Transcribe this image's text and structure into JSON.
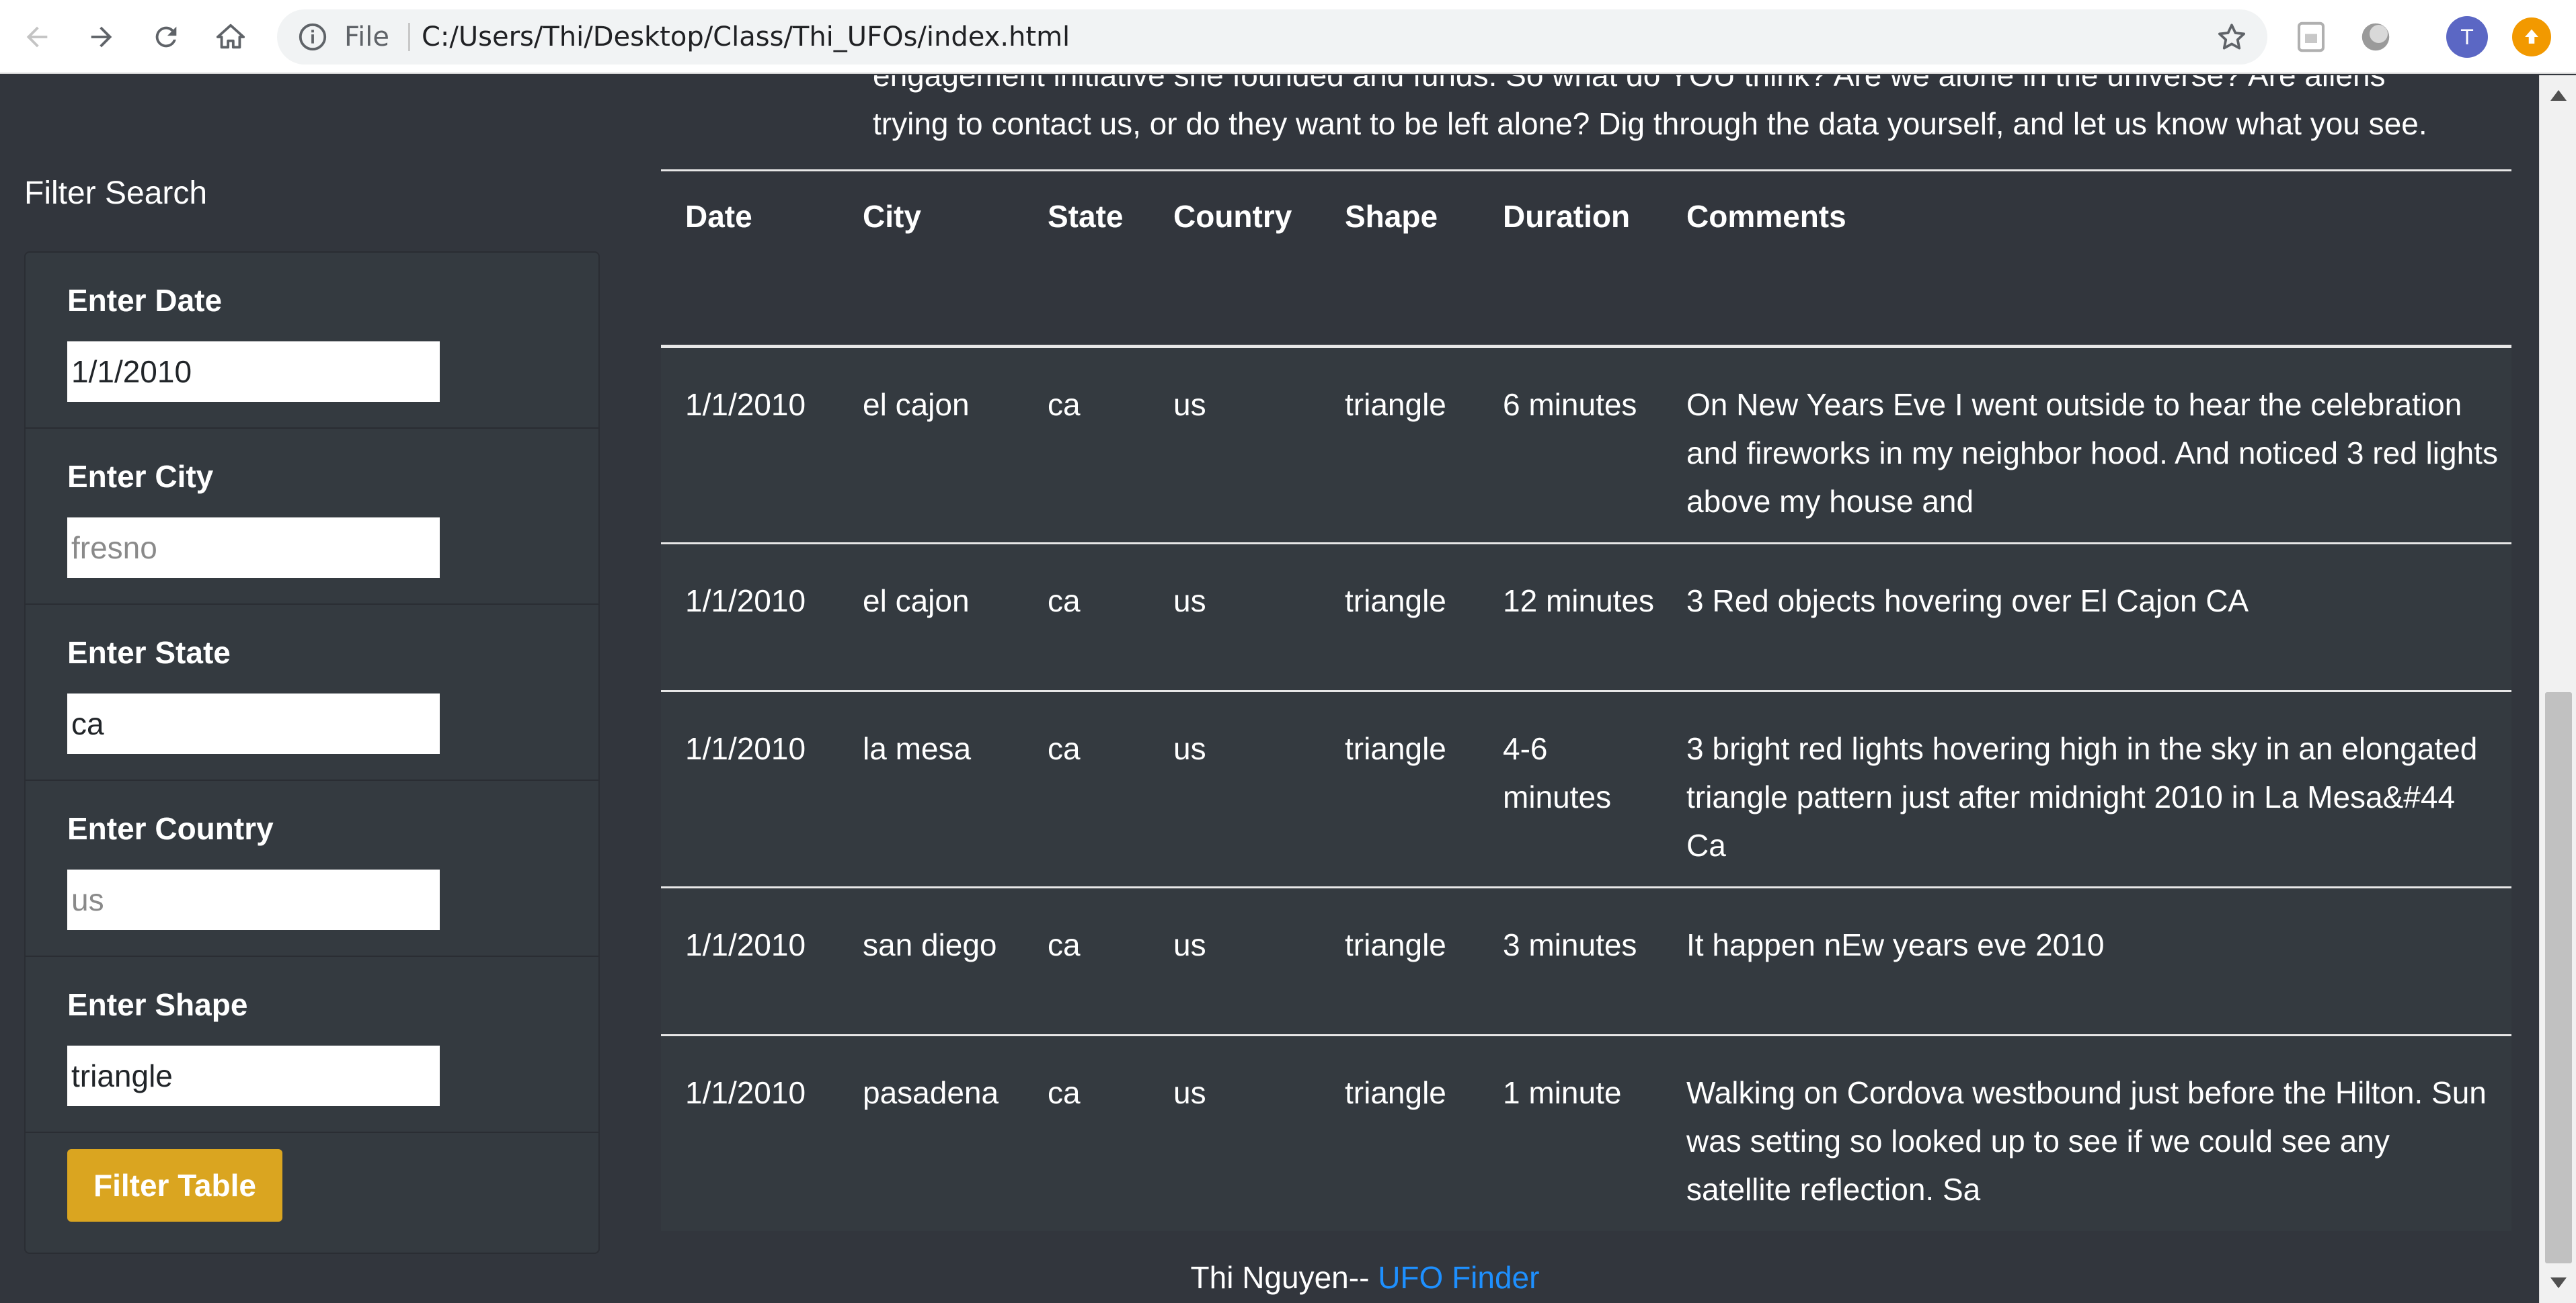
{
  "browser": {
    "scheme_label": "File",
    "url": "C:/Users/Thi/Desktop/Class/Thi_UFOs/index.html",
    "avatar_letter": "T",
    "icons": [
      "back-arrow-icon",
      "forward-arrow-icon",
      "reload-icon",
      "home-icon",
      "info-icon",
      "star-icon",
      "extension-icon",
      "update-icon"
    ]
  },
  "intro": {
    "line1": "engagement initiative she founded and funds. So what do YOU think? Are we alone in the universe? Are aliens",
    "line2": "trying to contact us, or do they want to be left alone? Dig through the data yourself, and let us know what you see."
  },
  "filter": {
    "heading": "Filter Search",
    "fields": [
      {
        "label": "Enter Date",
        "value": "1/1/2010",
        "placeholder": ""
      },
      {
        "label": "Enter City",
        "value": "",
        "placeholder": "fresno"
      },
      {
        "label": "Enter State",
        "value": "ca",
        "placeholder": ""
      },
      {
        "label": "Enter Country",
        "value": "",
        "placeholder": "us"
      },
      {
        "label": "Enter Shape",
        "value": "triangle",
        "placeholder": ""
      }
    ],
    "button": "Filter Table"
  },
  "table": {
    "headers": [
      "Date",
      "City",
      "State",
      "Country",
      "Shape",
      "Duration",
      "Comments"
    ],
    "rows": [
      {
        "date": "1/1/2010",
        "city": "el cajon",
        "state": "ca",
        "country": "us",
        "shape": "triangle",
        "duration": "6 minutes",
        "comments": "On New Years Eve I went outside to hear the celebration and fireworks in my neighbor hood. And noticed 3 red lights above my house and"
      },
      {
        "date": "1/1/2010",
        "city": "el cajon",
        "state": "ca",
        "country": "us",
        "shape": "triangle",
        "duration": "12 minutes",
        "comments": "3 Red objects hovering over El Cajon CA"
      },
      {
        "date": "1/1/2010",
        "city": "la mesa",
        "state": "ca",
        "country": "us",
        "shape": "triangle",
        "duration": "4-6 minutes",
        "comments": "3 bright red lights hovering high in the sky in an elongated triangle pattern just after midnight 2010 in La Mesa&#44 Ca"
      },
      {
        "date": "1/1/2010",
        "city": "san diego",
        "state": "ca",
        "country": "us",
        "shape": "triangle",
        "duration": "3 minutes",
        "comments": "It happen nEw years eve 2010"
      },
      {
        "date": "1/1/2010",
        "city": "pasadena",
        "state": "ca",
        "country": "us",
        "shape": "triangle",
        "duration": "1 minute",
        "comments": "Walking on Cordova westbound just before the Hilton. Sun was setting so looked up to see if we could see any satellite reflection. Sa"
      }
    ]
  },
  "footer": {
    "author": "Thi Nguyen-- ",
    "link": "UFO Finder"
  },
  "colors": {
    "page_background": "#32363d",
    "panel_background": "#343a40",
    "button_background": "#daa520",
    "link": "#1e90ff"
  }
}
